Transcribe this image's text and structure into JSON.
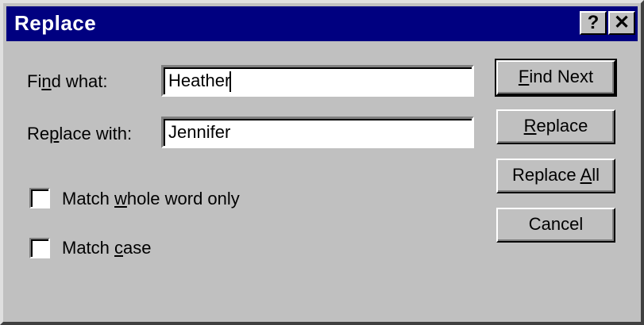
{
  "window": {
    "title": "Replace",
    "help_button": "?",
    "close_button": "✕"
  },
  "fields": {
    "find_label_pre": "Fi",
    "find_label_mnemonic": "n",
    "find_label_post": "d what:",
    "find_value": "Heather",
    "replace_label_pre": "Re",
    "replace_label_mnemonic": "p",
    "replace_label_post": "lace with:",
    "replace_value": "Jennifer"
  },
  "options": {
    "whole_word_pre": "Match ",
    "whole_word_mnemonic": "w",
    "whole_word_post": "hole word only",
    "whole_word_checked": false,
    "match_case_pre": "Match ",
    "match_case_mnemonic": "c",
    "match_case_post": "ase",
    "match_case_checked": false
  },
  "buttons": {
    "find_next_mnemonic": "F",
    "find_next_post": "ind Next",
    "replace_mnemonic": "R",
    "replace_post": "eplace",
    "replace_all_pre": "Replace ",
    "replace_all_mnemonic": "A",
    "replace_all_post": "ll",
    "cancel": "Cancel"
  },
  "colors": {
    "titlebar": "#000080",
    "face": "#c0c0c0"
  }
}
